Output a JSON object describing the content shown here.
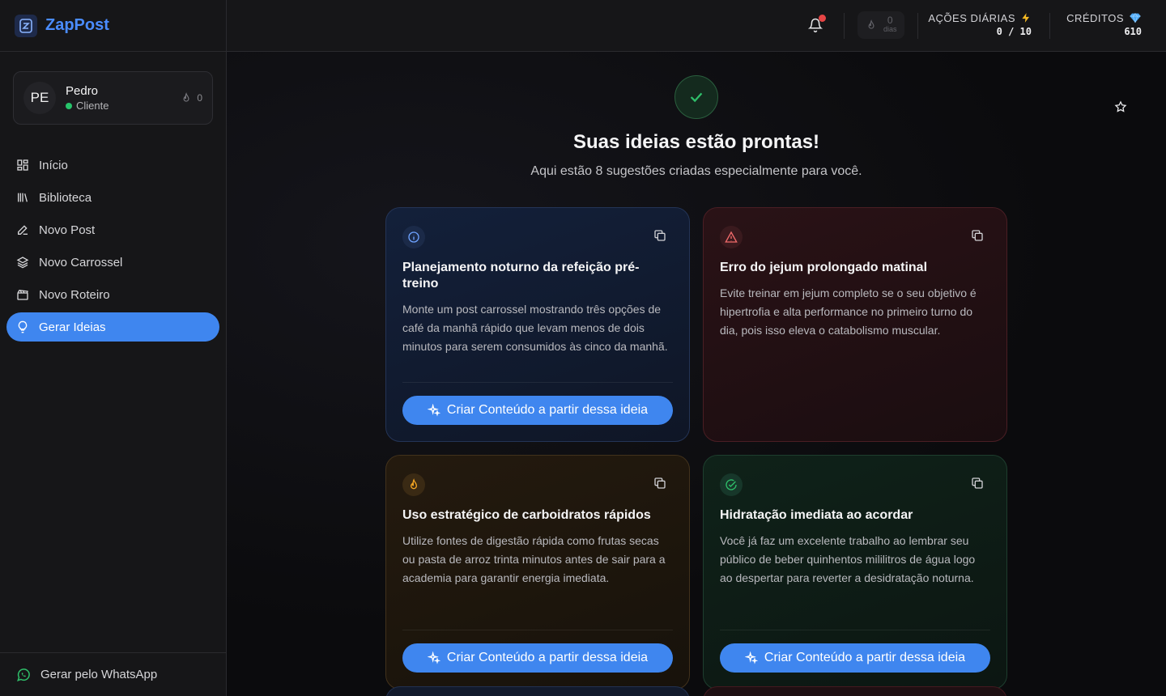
{
  "brand": {
    "logo_text": "Z",
    "name": "ZapPost"
  },
  "user": {
    "initials": "PE",
    "name": "Pedro",
    "role": "Cliente",
    "streak": "0"
  },
  "nav": [
    {
      "label": "Início",
      "icon": "grid-icon"
    },
    {
      "label": "Biblioteca",
      "icon": "library-icon"
    },
    {
      "label": "Novo Post",
      "icon": "pen-icon"
    },
    {
      "label": "Novo Carrossel",
      "icon": "layers-icon"
    },
    {
      "label": "Novo Roteiro",
      "icon": "clapperboard-icon"
    },
    {
      "label": "Gerar Ideias",
      "icon": "lightbulb-icon",
      "active": true
    }
  ],
  "footer": {
    "label": "Gerar pelo WhatsApp"
  },
  "header": {
    "streak_value": "0",
    "streak_unit": "dias",
    "daily_label": "AÇÕES DIÁRIAS",
    "daily_value": "0 / 10",
    "credits_label": "CRÉDITOS",
    "credits_value": "610"
  },
  "hero": {
    "title": "Suas ideias estão prontas!",
    "subtitle": "Aqui estão 8 sugestões criadas especialmente para você."
  },
  "cards": [
    {
      "variant": "blue",
      "icon": "info-icon",
      "title": "Planejamento noturno da refeição pré-treino",
      "text": "Monte um post carrossel mostrando três opções de café da manhã rápido que levam menos de dois minutos para serem consumidos às cinco da manhã.",
      "action": "Criar Conteúdo a partir dessa ideia"
    },
    {
      "variant": "red",
      "icon": "warning-icon",
      "title": "Erro do jejum prolongado matinal",
      "text": "Evite treinar em jejum completo se o seu objetivo é hipertrofia e alta performance no primeiro turno do dia, pois isso eleva o catabolismo muscular.",
      "action": ""
    },
    {
      "variant": "amber",
      "icon": "flame-icon",
      "title": "Uso estratégico de carboidratos rápidos",
      "text": "Utilize fontes de digestão rápida como frutas secas ou pasta de arroz trinta minutos antes de sair para a academia para garantir energia imediata.",
      "action": "Criar Conteúdo a partir dessa ideia"
    },
    {
      "variant": "green",
      "icon": "check-circle-icon",
      "title": "Hidratação imediata ao acordar",
      "text": "Você já faz um excelente trabalho ao lembrar seu público de beber quinhentos mililitros de água logo ao despertar para reverter a desidratação noturna.",
      "action": "Criar Conteúdo a partir dessa ideia"
    }
  ],
  "colors": {
    "accent": "#3f86ef",
    "brand": "#4a8cff",
    "online": "#27c46b",
    "notification": "#e64545",
    "success": "#2fbf6a"
  }
}
